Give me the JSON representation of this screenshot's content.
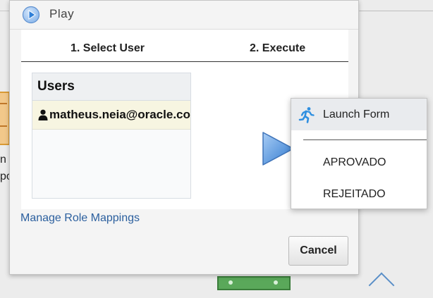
{
  "background": {
    "partial_text_1": "n",
    "partial_text_2": "po"
  },
  "dialog": {
    "title": "Play",
    "steps": [
      {
        "label": "1. Select User"
      },
      {
        "label": "2. Execute"
      }
    ],
    "users": {
      "header": "Users",
      "items": [
        {
          "email": "matheus.neia@oracle.com"
        }
      ]
    },
    "link": "Manage Role Mappings",
    "cancel_label": "Cancel"
  },
  "menu": {
    "items": [
      {
        "label": "Launch Form",
        "icon": "running-person-icon"
      },
      {
        "label": "APROVADO"
      },
      {
        "label": "REJEITADO"
      }
    ]
  },
  "colors": {
    "accent": "#2f7fd8",
    "link": "#2b5f9e",
    "selected_row": "#f7f5e1"
  }
}
